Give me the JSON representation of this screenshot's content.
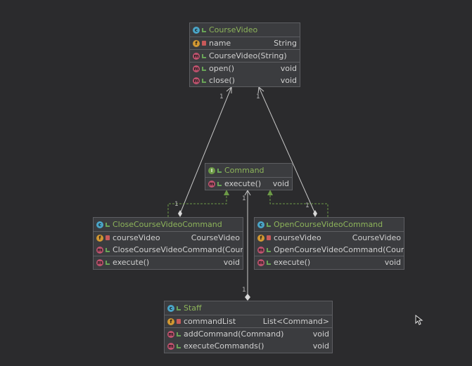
{
  "colors": {
    "background": "#2b2b2d",
    "class_fill": "#3b3c3f",
    "class_border": "#5d5e62",
    "class_title": "#8db45a",
    "association_line": "#c8c8c8",
    "realization_line": "#6c9a46",
    "badge_class": "#4aa5c8",
    "badge_interface": "#6c9a46",
    "badge_field": "#d29832",
    "badge_method": "#c0526e"
  },
  "classes": {
    "course_video": {
      "name": "CourseVideo",
      "kind_badge": "c",
      "fields": [
        {
          "badge": "f",
          "name": "name",
          "type": "String"
        }
      ],
      "constructors": [
        {
          "badge": "m",
          "name": "CourseVideo(String)",
          "type": ""
        }
      ],
      "methods": [
        {
          "badge": "m",
          "name": "open()",
          "type": "void"
        },
        {
          "badge": "m",
          "name": "close()",
          "type": "void"
        }
      ]
    },
    "command": {
      "name": "Command",
      "kind_badge": "I",
      "methods": [
        {
          "badge": "m",
          "name": "execute()",
          "type": "void"
        }
      ]
    },
    "close_cmd": {
      "name": "CloseCourseVideoCommand",
      "kind_badge": "c",
      "fields": [
        {
          "badge": "f",
          "name": "courseVideo",
          "type": "CourseVideo"
        }
      ],
      "constructors": [
        {
          "badge": "m",
          "name": "CloseCourseVideoCommand(Cours",
          "type": ""
        }
      ],
      "methods": [
        {
          "badge": "m",
          "name": "execute()",
          "type": "void"
        }
      ]
    },
    "open_cmd": {
      "name": "OpenCourseVideoCommand",
      "kind_badge": "c",
      "fields": [
        {
          "badge": "f",
          "name": "courseVideo",
          "type": "CourseVideo"
        }
      ],
      "constructors": [
        {
          "badge": "m",
          "name": "OpenCourseVideoCommand(Cours",
          "type": ""
        }
      ],
      "methods": [
        {
          "badge": "m",
          "name": "execute()",
          "type": "void"
        }
      ]
    },
    "staff": {
      "name": "Staff",
      "kind_badge": "c",
      "fields": [
        {
          "badge": "f",
          "name": "commandList",
          "type": "List<Command>"
        }
      ],
      "methods": [
        {
          "badge": "m",
          "name": "addCommand(Command)",
          "type": "void"
        },
        {
          "badge": "m",
          "name": "executeCommands()",
          "type": "void"
        }
      ]
    }
  },
  "multiplicities": {
    "close_to_video": "1",
    "open_to_video": "1",
    "close_source": "1",
    "open_source": "1",
    "staff_to_command": "1",
    "staff_source": "1"
  }
}
